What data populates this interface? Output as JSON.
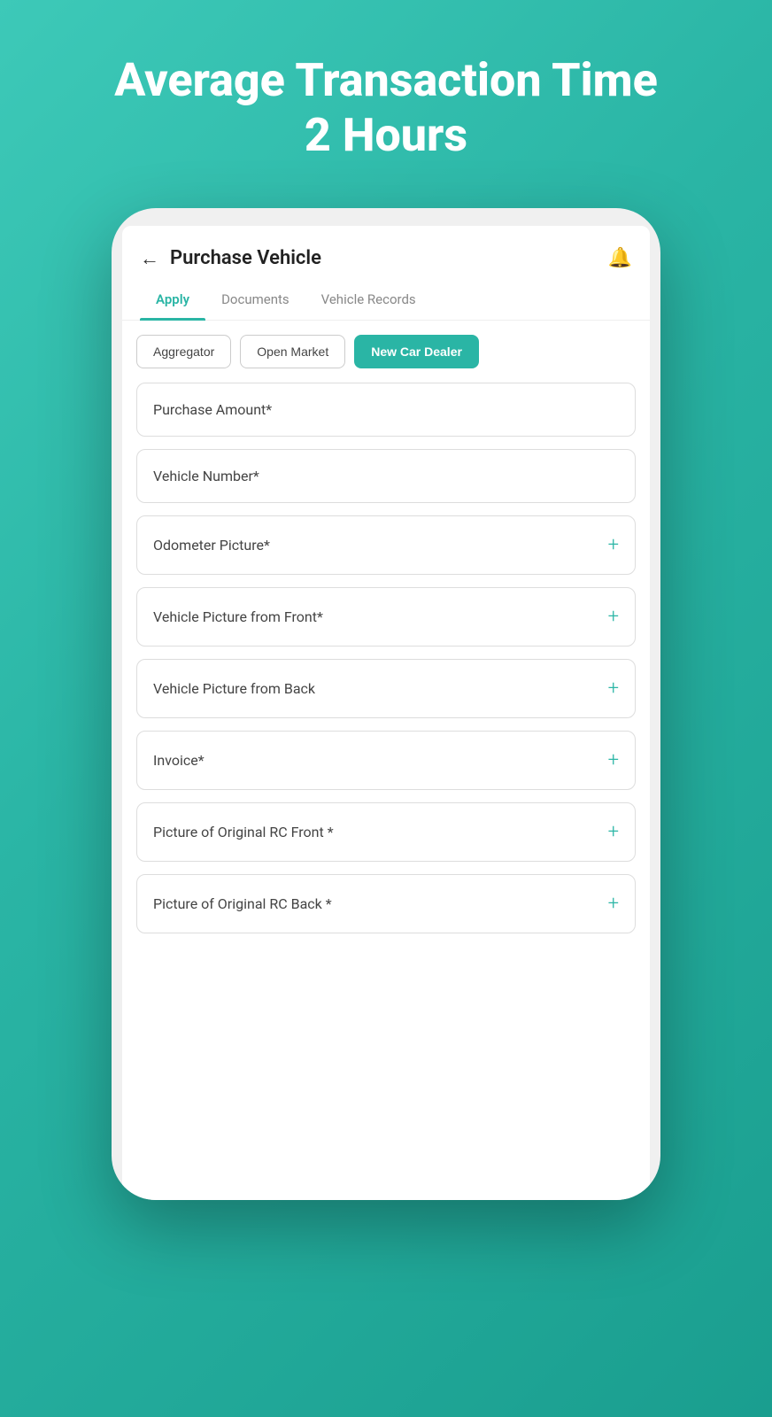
{
  "hero": {
    "title_line1": "Average Transaction Time",
    "title_line2": "2 Hours"
  },
  "header": {
    "back_label": "←",
    "title": "Purchase Vehicle",
    "bell_icon": "🔔"
  },
  "tabs": [
    {
      "id": "apply",
      "label": "Apply",
      "active": true
    },
    {
      "id": "documents",
      "label": "Documents",
      "active": false
    },
    {
      "id": "vehicle_records",
      "label": "Vehicle Records",
      "active": false
    }
  ],
  "segments": [
    {
      "id": "aggregator",
      "label": "Aggregator",
      "active": false
    },
    {
      "id": "open_market",
      "label": "Open Market",
      "active": false
    },
    {
      "id": "new_car_dealer",
      "label": "New Car Dealer",
      "active": true
    }
  ],
  "form_fields": [
    {
      "id": "purchase_amount",
      "label": "Purchase Amount*",
      "has_plus": false
    },
    {
      "id": "vehicle_number",
      "label": "Vehicle Number*",
      "has_plus": false
    },
    {
      "id": "odometer_picture",
      "label": "Odometer Picture*",
      "has_plus": true
    },
    {
      "id": "vehicle_front",
      "label": "Vehicle Picture from Front*",
      "has_plus": true
    },
    {
      "id": "vehicle_back",
      "label": "Vehicle Picture from Back",
      "has_plus": true
    },
    {
      "id": "invoice",
      "label": "Invoice*",
      "has_plus": true
    },
    {
      "id": "rc_front",
      "label": "Picture of Original RC Front *",
      "has_plus": true
    },
    {
      "id": "rc_back",
      "label": "Picture of Original RC Back *",
      "has_plus": true
    }
  ],
  "colors": {
    "accent": "#2ab5a5",
    "background_gradient_start": "#3dc9b8",
    "background_gradient_end": "#1a9e8f"
  }
}
